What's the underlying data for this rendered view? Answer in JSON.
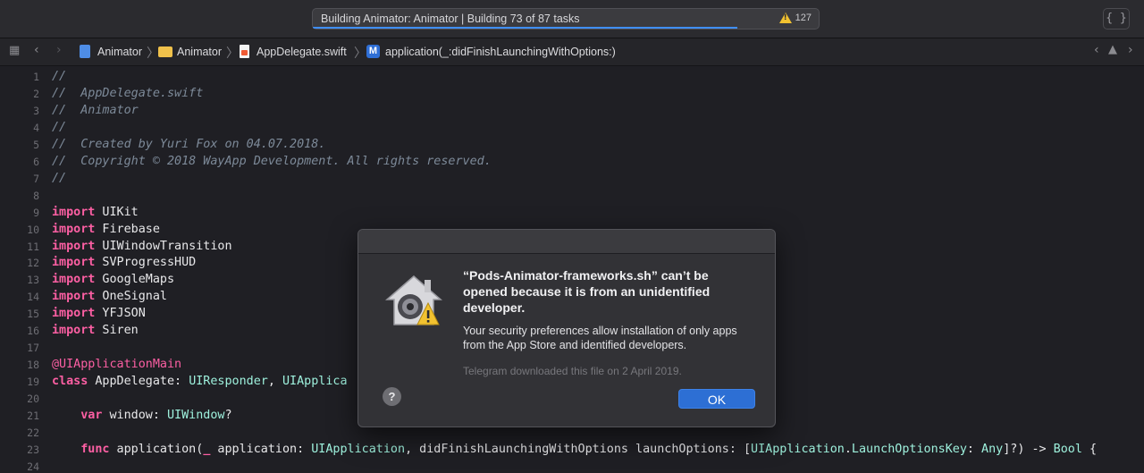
{
  "toolbar": {
    "activity_text": "Building Animator: Animator | Building 73 of 87 tasks",
    "build_progress": 0.84,
    "warning_count": "127",
    "braces_label": "{ }"
  },
  "jumpbar": {
    "crumbs": [
      "Animator",
      "Animator",
      "AppDelegate.swift",
      "application(_:didFinishLaunchingWithOptions:)"
    ],
    "method_badge": "M"
  },
  "editor": {
    "line_numbers": [
      "1",
      "2",
      "3",
      "4",
      "5",
      "6",
      "7",
      "8",
      "9",
      "10",
      "11",
      "12",
      "13",
      "14",
      "15",
      "16",
      "17",
      "18",
      "19",
      "20",
      "21",
      "22",
      "23",
      "24"
    ],
    "lines": [
      "//",
      "//  AppDelegate.swift",
      "//  Animator",
      "//",
      "//  Created by Yuri Fox on 04.07.2018.",
      "//  Copyright © 2018 WayApp Development. All rights reserved.",
      "//",
      "",
      "import UIKit",
      "import Firebase",
      "import UIWindowTransition",
      "import SVProgressHUD",
      "import GoogleMaps",
      "import OneSignal",
      "import YFJSON",
      "import Siren",
      "",
      "@UIApplicationMain",
      "class AppDelegate: UIResponder, UIApplica",
      "",
      "    var window: UIWindow?",
      "",
      "    func application(_ application: UIApplication, didFinishLaunchingWithOptions launchOptions: [UIApplication.LaunchOptionsKey: Any]?) -> Bool {",
      ""
    ]
  },
  "dialog": {
    "title": "“Pods-Animator-frameworks.sh” can’t be opened because it is from an unidentified developer.",
    "body": "Your security preferences allow installation of only apps from the App Store and identified developers.",
    "note": "Telegram downloaded this file on 2 April 2019.",
    "help_label": "?",
    "ok_label": "OK"
  },
  "colors": {
    "keyword": "#fc5fa3",
    "type": "#9ef1dd",
    "comment": "#7d8a99",
    "accent": "#2d6fd4",
    "warning": "#f2c230"
  }
}
